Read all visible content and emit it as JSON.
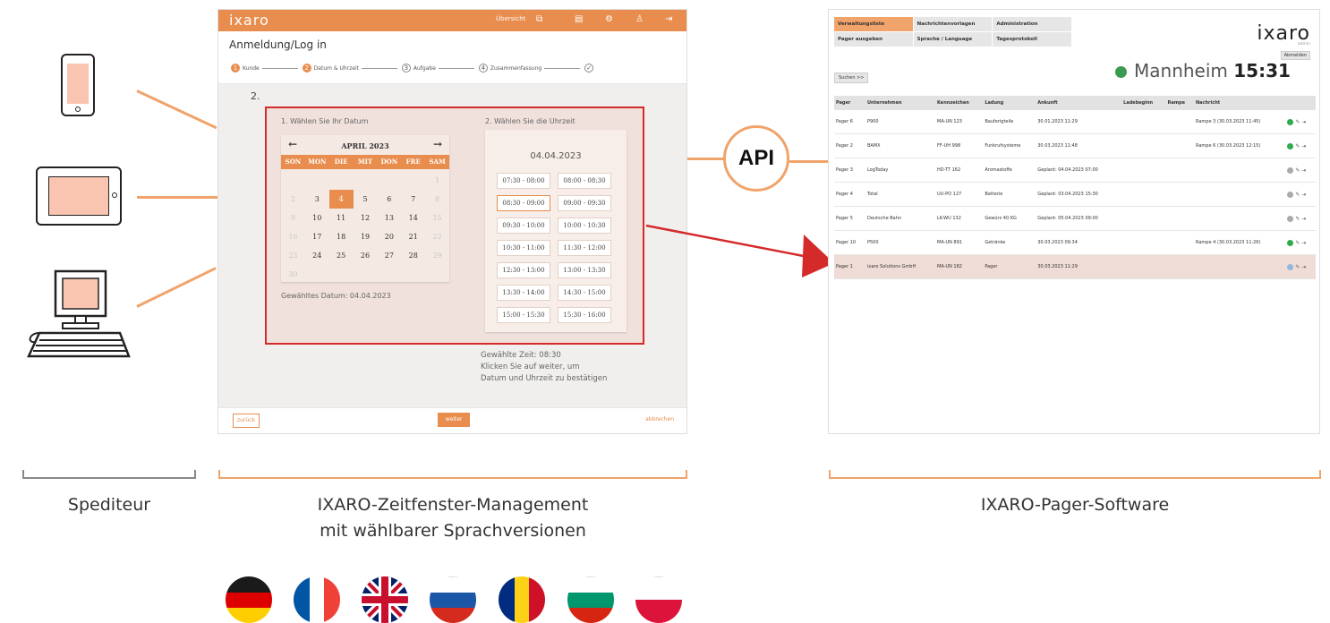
{
  "left": {
    "caption": "Spediteur"
  },
  "booking": {
    "logo": "ixaro",
    "nav": {
      "overview": "Übersicht"
    },
    "title": "Anmeldung/Log in",
    "steps": [
      {
        "num": "1",
        "label": "Kunde"
      },
      {
        "num": "2",
        "label": "Datum & Uhrzeit"
      },
      {
        "num": "3",
        "label": "Aufgabe"
      },
      {
        "num": "4",
        "label": "Zusammenfassung"
      },
      {
        "num": "✓",
        "label": ""
      }
    ],
    "step_heading": "2.",
    "date_label": "1. Wählen Sie Ihr Datum",
    "time_label": "2. Wählen Sie die Uhrzeit",
    "calendar": {
      "month": "APRIL 2023",
      "weekdays": [
        "SON",
        "MON",
        "DIE",
        "MIT",
        "DON",
        "FRE",
        "SAM"
      ],
      "days": [
        "",
        "",
        "",
        "",
        "",
        "",
        "1",
        "2",
        "3",
        "4",
        "5",
        "6",
        "7",
        "8",
        "9",
        "10",
        "11",
        "12",
        "13",
        "14",
        "15",
        "16",
        "17",
        "18",
        "19",
        "20",
        "21",
        "22",
        "23",
        "24",
        "25",
        "26",
        "27",
        "28",
        "29",
        "30"
      ],
      "selected": "4"
    },
    "chosen_date": "Gewähltes Datum: 04.04.2023",
    "times_date": "04.04.2023",
    "slots": [
      "07:30 - 08:00",
      "08:00 - 08:30",
      "08:30 - 09:00",
      "09:00 - 09:30",
      "09:30 - 10:00",
      "10:00 - 10:30",
      "10:30 - 11:00",
      "11:30 - 12:00",
      "12:30 - 13:00",
      "13:00 - 13:30",
      "13:30 - 14:00",
      "14:30 - 15:00",
      "15:00 - 15:30",
      "15:30 - 16:00"
    ],
    "selected_slot": "08:30 - 09:00",
    "chosen_time": "Gewählte Zeit: 08:30",
    "hint1": "Klicken Sie auf weiter, um",
    "hint2": "Datum und Uhrzeit zu bestätigen",
    "btn_back": "zurück",
    "btn_next": "weiter",
    "btn_cancel": "abbrechen",
    "caption_line1": "IXARO-Zeitfenster-Management",
    "caption_line2": "mit wählbarer Sprachversionen"
  },
  "api_label": "API",
  "pager": {
    "menu": [
      "Verwaltungsliste",
      "Nachrichtenvorlagen",
      "Administration",
      "Pager ausgeben",
      "Sprache / Language",
      "Tagesprotokoll"
    ],
    "logo": "ixaro",
    "user": "admin",
    "logout": "Abmelden",
    "search": "Suchen >>",
    "city": "Mannheim",
    "time": "15:31",
    "columns": [
      "Pager",
      "Unternehmen",
      "Kennzeichen",
      "Ladung",
      "Ankunft",
      "Ladebeginn",
      "Rampe",
      "Nachricht",
      ""
    ],
    "rows": [
      {
        "pager": "Pager 6",
        "company": "P900",
        "plate": "MA-UN 123",
        "cargo": "Bauferigteile",
        "arrival": "30.01.2023 11:29",
        "msg": "Rampe 3 (30.03.2023 11:45)",
        "status": "#2eaa4a",
        "hl": false
      },
      {
        "pager": "Pager 2",
        "company": "BAMX",
        "plate": "FF-UH 998",
        "cargo": "Funkrufsysteme",
        "arrival": "30.03.2023 11:48",
        "msg": "Rampe 6 (30.03.2023 12:15)",
        "status": "#2eaa4a",
        "hl": false
      },
      {
        "pager": "Pager 3",
        "company": "LogToday",
        "plate": "HD-TT 162",
        "cargo": "Aromastoffe",
        "arrival": "Geplant: 04.04.2023 07:00",
        "msg": "",
        "status": "#aaaaaa",
        "hl": false
      },
      {
        "pager": "Pager 4",
        "company": "Total",
        "plate": "UU-PO 127",
        "cargo": "Batterie",
        "arrival": "Geplant: 03.04.2023 15:30",
        "msg": "",
        "status": "#aaaaaa",
        "hl": false
      },
      {
        "pager": "Pager 5",
        "company": "Deutsche Bahn",
        "plate": "LK-WU 132",
        "cargo": "Gewürz 40 KG",
        "arrival": "Geplant: 05.04.2023 09:00",
        "msg": "",
        "status": "#aaaaaa",
        "hl": false
      },
      {
        "pager": "Pager 10",
        "company": "P500",
        "plate": "MA-UN 891",
        "cargo": "Getränke",
        "arrival": "30.03.2023 09:34",
        "msg": "Rampe 4 (30.03.2023 11:26)",
        "status": "#2eaa4a",
        "hl": false
      },
      {
        "pager": "Pager 1",
        "company": "ixaro Solutions GmbH",
        "plate": "MA-UN 182",
        "cargo": "Pager",
        "arrival": "30.03.2023 11:29",
        "msg": "",
        "status": "#8fb7e0",
        "hl": true
      }
    ],
    "caption": "IXARO-Pager-Software"
  },
  "flags": [
    "germany",
    "france",
    "united-kingdom",
    "russia",
    "romania",
    "bulgaria",
    "poland"
  ]
}
